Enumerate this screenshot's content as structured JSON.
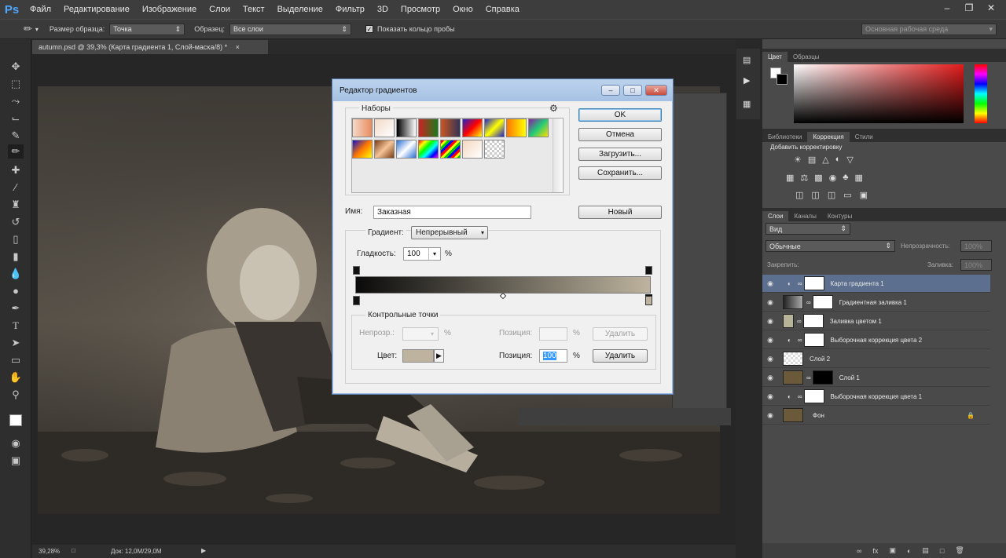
{
  "menu": {
    "logo": "Ps",
    "items": [
      "Файл",
      "Редактирование",
      "Изображение",
      "Слои",
      "Текст",
      "Выделение",
      "Фильтр",
      "3D",
      "Просмотр",
      "Окно",
      "Справка"
    ]
  },
  "options_bar": {
    "sample_size_label": "Размер образца:",
    "sample_size_value": "Точка",
    "sample_label": "Образец:",
    "sample_value": "Все слои",
    "show_ring_label": "Показать кольцо пробы",
    "workspace": "Основная рабочая среда"
  },
  "document": {
    "tab_title": "autumn.psd @ 39,3% (Карта градиента 1, Слой-маска/8) *",
    "zoom": "39,28%",
    "doc_size": "Док: 12,0M/29,0M"
  },
  "color_panel": {
    "tabs": [
      "Цвет",
      "Образцы"
    ]
  },
  "adjustments_panel": {
    "tabs": [
      "Библиотеки",
      "Коррекция",
      "Стили"
    ],
    "add_label": "Добавить корректировку"
  },
  "layers_panel": {
    "tabs": [
      "Слои",
      "Каналы",
      "Контуры"
    ],
    "filter_kind": "Вид",
    "blend_mode": "Обычные",
    "opacity_label": "Непрозрачность:",
    "opacity_value": "100%",
    "lock_label": "Закрепить:",
    "fill_label": "Заливка:",
    "fill_value": "100%",
    "layers": [
      {
        "name": "Карта градиента 1",
        "selected": true
      },
      {
        "name": "Градиентная заливка 1",
        "selected": false
      },
      {
        "name": "Заливка цветом 1",
        "selected": false
      },
      {
        "name": "Выборочная коррекция цвета 2",
        "selected": false
      },
      {
        "name": "Слой 2",
        "selected": false
      },
      {
        "name": "Слой 1",
        "selected": false
      },
      {
        "name": "Выборочная коррекция цвета 1",
        "selected": false
      },
      {
        "name": "Фон",
        "selected": false
      }
    ]
  },
  "gradient_editor": {
    "title": "Редактор градиентов",
    "presets_label": "Наборы",
    "buttons": {
      "ok": "OK",
      "cancel": "Отмена",
      "load": "Загрузить...",
      "save": "Сохранить...",
      "new": "Новый"
    },
    "name_label": "Имя:",
    "name_value": "Заказная",
    "gradient_type_label": "Градиент:",
    "gradient_type_value": "Непрерывный",
    "smoothness_label": "Гладкость:",
    "smoothness_value": "100",
    "smoothness_unit": "%",
    "stops_group_label": "Контрольные точки",
    "opacity_label": "Непрозр.:",
    "opacity_unit": "%",
    "position_label": "Позиция:",
    "position_unit": "%",
    "delete_label": "Удалить",
    "color_label": "Цвет:",
    "color_position_label": "Позиция:",
    "color_position_value": "100",
    "color_position_unit": "%",
    "colors": {
      "gradient_start": "#0a0a0a",
      "gradient_end": "#bdb39e",
      "stop_color": "#bdb39e"
    }
  }
}
